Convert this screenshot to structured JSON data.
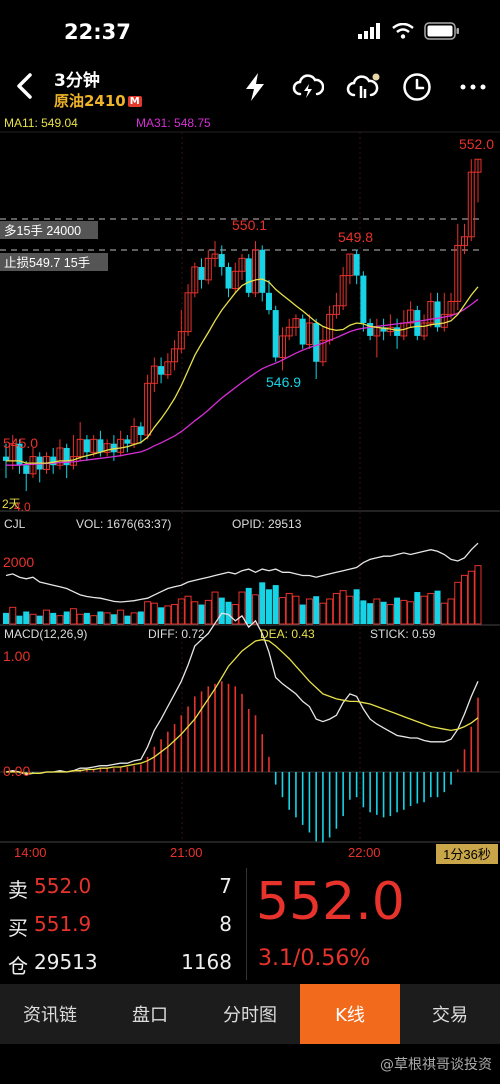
{
  "status_bar": {
    "time": "22:37"
  },
  "nav": {
    "title": "3分钟",
    "subtitle": "原油2410",
    "badge": "M",
    "icons": [
      "flash-icon",
      "cloud-sync-icon",
      "cloud-notify-icon",
      "clock-icon",
      "more-icon"
    ]
  },
  "kline": {
    "ma11_label": "MA11: 549.04",
    "ma31_label": "MA31: 548.75",
    "price_top": "552.0",
    "price_bottom": "545.0",
    "high_label_1": "550.1",
    "high_label_2": "549.8",
    "low_label": "546.9",
    "order_1": "多15手 24000",
    "order_2": "止损549.7 15手",
    "period_tag": "2天",
    "axis_partial": "4.0",
    "colors": {
      "up": "#e8322c",
      "down": "#16d3e6",
      "ma11": "#e6e04a",
      "ma31": "#d62fd6"
    }
  },
  "volume": {
    "title": "CJL",
    "vol_label": "VOL: 1676(63:37)",
    "opid_label": "OPID: 29513",
    "axis_value": "2000"
  },
  "macd": {
    "title": "MACD(12,26,9)",
    "diff_label": "DIFF: 0.72",
    "dea_label": "DEA: 0.43",
    "stick_label": "STICK: 0.59",
    "axis_top": "1.00",
    "axis_zero": "0.00"
  },
  "time_axis": {
    "t1": "14:00",
    "t2": "21:00",
    "t3": "22:00",
    "countdown": "1分36秒"
  },
  "chart_data": {
    "type": "candlestick",
    "y_range": [
      544.0,
      552.4
    ],
    "candles": [
      [
        545.1,
        545.0,
        544.6,
        545.4
      ],
      [
        545.0,
        545.4,
        544.8,
        545.6
      ],
      [
        545.4,
        544.9,
        544.7,
        545.5
      ],
      [
        544.9,
        544.7,
        544.3,
        545.0
      ],
      [
        544.7,
        545.1,
        544.6,
        545.3
      ],
      [
        545.1,
        544.8,
        544.5,
        545.2
      ],
      [
        544.8,
        545.1,
        544.7,
        545.2
      ],
      [
        545.1,
        544.9,
        544.7,
        545.3
      ],
      [
        544.9,
        545.3,
        544.8,
        545.5
      ],
      [
        545.3,
        544.9,
        544.6,
        545.4
      ],
      [
        544.9,
        545.1,
        544.8,
        545.6
      ],
      [
        545.1,
        545.5,
        545.0,
        545.9
      ],
      [
        545.5,
        545.2,
        545.0,
        545.6
      ],
      [
        545.2,
        545.5,
        545.1,
        545.6
      ],
      [
        545.5,
        545.2,
        545.1,
        545.7
      ],
      [
        545.2,
        545.4,
        545.1,
        545.5
      ],
      [
        545.4,
        545.2,
        545.0,
        545.6
      ],
      [
        545.2,
        545.5,
        545.1,
        545.7
      ],
      [
        545.5,
        545.4,
        545.2,
        545.6
      ],
      [
        545.4,
        545.8,
        545.3,
        546.0
      ],
      [
        545.8,
        545.6,
        545.4,
        545.9
      ],
      [
        545.6,
        546.8,
        545.5,
        547.0
      ],
      [
        546.8,
        547.2,
        546.6,
        547.4
      ],
      [
        547.2,
        547.0,
        546.8,
        547.4
      ],
      [
        547.0,
        547.3,
        546.9,
        547.5
      ],
      [
        547.3,
        547.6,
        547.1,
        547.8
      ],
      [
        547.6,
        548.0,
        547.5,
        548.5
      ],
      [
        548.0,
        548.9,
        547.9,
        549.1
      ],
      [
        548.9,
        549.5,
        548.8,
        549.6
      ],
      [
        549.5,
        549.2,
        549.0,
        549.7
      ],
      [
        549.2,
        549.7,
        549.1,
        549.9
      ],
      [
        549.7,
        549.8,
        549.5,
        550.1
      ],
      [
        549.8,
        549.5,
        549.3,
        550.0
      ],
      [
        549.5,
        549.0,
        548.8,
        549.6
      ],
      [
        549.0,
        549.4,
        548.9,
        549.6
      ],
      [
        549.4,
        549.7,
        549.2,
        549.8
      ],
      [
        549.7,
        548.9,
        548.8,
        549.8
      ],
      [
        548.9,
        549.9,
        548.8,
        550.1
      ],
      [
        549.9,
        548.9,
        548.7,
        550.0
      ],
      [
        548.9,
        548.5,
        548.4,
        549.2
      ],
      [
        548.5,
        547.4,
        547.3,
        548.6
      ],
      [
        547.4,
        547.9,
        547.1,
        548.1
      ],
      [
        547.9,
        548.1,
        547.8,
        548.3
      ],
      [
        548.1,
        548.3,
        547.9,
        548.4
      ],
      [
        548.3,
        547.7,
        547.6,
        548.4
      ],
      [
        547.7,
        548.2,
        547.6,
        548.4
      ],
      [
        548.2,
        547.3,
        546.9,
        548.3
      ],
      [
        547.3,
        547.8,
        547.2,
        548.1
      ],
      [
        547.8,
        548.4,
        547.7,
        548.6
      ],
      [
        548.4,
        548.6,
        548.3,
        548.9
      ],
      [
        548.6,
        549.3,
        548.5,
        549.5
      ],
      [
        549.3,
        549.8,
        549.1,
        549.8
      ],
      [
        549.8,
        549.3,
        549.1,
        549.9
      ],
      [
        549.3,
        548.2,
        548.0,
        549.4
      ],
      [
        548.2,
        547.9,
        547.8,
        548.3
      ],
      [
        547.9,
        548.1,
        547.4,
        548.3
      ],
      [
        548.1,
        548.0,
        547.8,
        548.3
      ],
      [
        548.0,
        548.1,
        547.9,
        548.4
      ],
      [
        548.1,
        547.9,
        547.6,
        548.3
      ],
      [
        547.9,
        548.2,
        547.8,
        548.5
      ],
      [
        548.2,
        548.5,
        548.1,
        548.7
      ],
      [
        548.5,
        547.9,
        547.8,
        548.6
      ],
      [
        547.9,
        548.2,
        547.8,
        548.4
      ],
      [
        548.2,
        548.7,
        548.1,
        548.9
      ],
      [
        548.7,
        548.1,
        548.0,
        548.9
      ],
      [
        548.1,
        548.4,
        548.0,
        548.9
      ],
      [
        548.4,
        548.7,
        548.3,
        548.9
      ],
      [
        548.7,
        550.0,
        548.5,
        550.5
      ],
      [
        550.0,
        550.2,
        549.8,
        550.5
      ],
      [
        550.2,
        551.7,
        550.1,
        552.0
      ],
      [
        551.7,
        552.0,
        551.0,
        552.0
      ]
    ],
    "ma11": [
      545.0,
      545.0,
      545.0,
      544.95,
      544.95,
      544.95,
      544.95,
      544.97,
      545.0,
      545.0,
      545.02,
      545.08,
      545.12,
      545.16,
      545.2,
      545.25,
      545.28,
      545.3,
      545.33,
      545.38,
      545.43,
      545.55,
      545.78,
      545.98,
      546.2,
      546.45,
      546.75,
      547.1,
      547.45,
      547.72,
      547.98,
      548.25,
      548.5,
      548.7,
      548.9,
      549.07,
      549.15,
      549.2,
      549.22,
      549.15,
      548.98,
      548.85,
      548.73,
      548.6,
      548.48,
      548.35,
      548.22,
      548.12,
      548.06,
      548.03,
      548.05,
      548.15,
      548.2,
      548.18,
      548.12,
      548.1,
      548.08,
      548.06,
      548.03,
      548.05,
      548.1,
      548.12,
      548.12,
      548.16,
      548.18,
      548.2,
      548.25,
      548.4,
      548.62,
      548.85,
      549.04
    ],
    "ma31": [
      544.9,
      544.9,
      544.9,
      544.92,
      544.92,
      544.93,
      544.94,
      544.95,
      544.96,
      544.97,
      544.98,
      545.0,
      545.02,
      545.04,
      545.06,
      545.08,
      545.1,
      545.12,
      545.15,
      545.18,
      545.21,
      545.27,
      545.35,
      545.42,
      545.5,
      545.58,
      545.68,
      545.8,
      545.93,
      546.05,
      546.18,
      546.32,
      546.46,
      546.58,
      546.7,
      546.82,
      546.93,
      547.04,
      547.14,
      547.21,
      547.27,
      547.34,
      547.42,
      547.5,
      547.57,
      547.63,
      547.68,
      547.73,
      547.8,
      547.86,
      547.93,
      548.0,
      548.05,
      548.08,
      548.1,
      548.12,
      548.14,
      548.16,
      548.18,
      548.2,
      548.22,
      548.24,
      548.26,
      548.29,
      548.31,
      548.34,
      548.37,
      548.43,
      548.52,
      548.63,
      548.75
    ],
    "volume": [
      80,
      120,
      60,
      90,
      70,
      60,
      100,
      80,
      60,
      90,
      110,
      70,
      80,
      60,
      90,
      80,
      70,
      100,
      60,
      80,
      90,
      160,
      150,
      120,
      130,
      140,
      180,
      200,
      160,
      140,
      170,
      230,
      190,
      160,
      140,
      230,
      260,
      210,
      300,
      250,
      280,
      190,
      220,
      200,
      140,
      180,
      200,
      150,
      180,
      220,
      240,
      200,
      250,
      170,
      150,
      180,
      160,
      140,
      190,
      170,
      160,
      230,
      200,
      220,
      240,
      150,
      180,
      300,
      350,
      380,
      420
    ],
    "macd_stick": [
      0.0,
      0.0,
      -0.01,
      -0.02,
      -0.01,
      0.0,
      0.0,
      0.0,
      0.01,
      0.0,
      0.01,
      0.02,
      0.02,
      0.02,
      0.03,
      0.03,
      0.03,
      0.04,
      0.04,
      0.05,
      0.06,
      0.12,
      0.2,
      0.26,
      0.32,
      0.38,
      0.45,
      0.52,
      0.6,
      0.64,
      0.68,
      0.7,
      0.72,
      0.7,
      0.68,
      0.62,
      0.5,
      0.45,
      0.3,
      0.12,
      -0.1,
      -0.2,
      -0.3,
      -0.36,
      -0.42,
      -0.48,
      -0.55,
      -0.56,
      -0.52,
      -0.45,
      -0.35,
      -0.22,
      -0.2,
      -0.28,
      -0.32,
      -0.34,
      -0.36,
      -0.35,
      -0.32,
      -0.3,
      -0.27,
      -0.25,
      -0.24,
      -0.2,
      -0.2,
      -0.16,
      -0.1,
      0.02,
      0.18,
      0.36,
      0.59
    ],
    "diff": [
      0.0,
      0.01,
      0.0,
      -0.02,
      -0.01,
      -0.01,
      0.0,
      0.0,
      0.01,
      0.0,
      0.01,
      0.03,
      0.03,
      0.04,
      0.05,
      0.05,
      0.06,
      0.07,
      0.07,
      0.09,
      0.1,
      0.2,
      0.33,
      0.42,
      0.52,
      0.62,
      0.72,
      0.85,
      1.0,
      1.05,
      1.1,
      1.18,
      1.26,
      1.25,
      1.2,
      1.24,
      1.15,
      1.2,
      1.1,
      0.95,
      0.75,
      0.7,
      0.66,
      0.62,
      0.56,
      0.52,
      0.42,
      0.4,
      0.42,
      0.45,
      0.55,
      0.62,
      0.6,
      0.5,
      0.42,
      0.38,
      0.35,
      0.32,
      0.29,
      0.28,
      0.27,
      0.27,
      0.25,
      0.24,
      0.24,
      0.24,
      0.26,
      0.34,
      0.46,
      0.6,
      0.72
    ],
    "dea": [
      0.0,
      0.0,
      0.0,
      -0.01,
      -0.01,
      -0.01,
      0.0,
      0.0,
      0.0,
      0.0,
      0.01,
      0.01,
      0.02,
      0.02,
      0.03,
      0.03,
      0.04,
      0.04,
      0.05,
      0.06,
      0.07,
      0.09,
      0.12,
      0.16,
      0.2,
      0.25,
      0.3,
      0.36,
      0.42,
      0.5,
      0.58,
      0.66,
      0.75,
      0.84,
      0.9,
      0.96,
      1.0,
      1.04,
      1.05,
      1.04,
      1.0,
      0.95,
      0.9,
      0.84,
      0.78,
      0.72,
      0.67,
      0.62,
      0.6,
      0.58,
      0.57,
      0.56,
      0.56,
      0.55,
      0.54,
      0.52,
      0.5,
      0.48,
      0.46,
      0.44,
      0.42,
      0.4,
      0.38,
      0.36,
      0.35,
      0.34,
      0.33,
      0.34,
      0.36,
      0.39,
      0.43
    ],
    "vol_line": [
      1500,
      1550,
      1450,
      1400,
      1450,
      1300,
      1250,
      1200,
      1150,
      1100,
      1000,
      900,
      850,
      820,
      800,
      750,
      700,
      680,
      700,
      720,
      760,
      800,
      900,
      1000,
      1100,
      1150,
      1200,
      1300,
      1350,
      1400,
      1450,
      1500,
      1550,
      1600,
      1550,
      1650,
      1700,
      1600,
      1700,
      1650,
      1700,
      1600,
      1600,
      1550,
      1500,
      1500,
      1450,
      1500,
      1550,
      1600,
      1650,
      1700,
      1750,
      1900,
      2000,
      2050,
      2100,
      2100,
      2150,
      2200,
      2150,
      2200,
      2250,
      2300,
      2250,
      2150,
      2000,
      1950,
      2050,
      2300,
      2500
    ]
  },
  "quote": {
    "sell_label": "卖",
    "sell_price": "552.0",
    "sell_qty": "7",
    "buy_label": "买",
    "buy_price": "551.9",
    "buy_qty": "8",
    "oi_label": "仓",
    "oi_value": "29513",
    "oi_change": "1168",
    "last_price": "552.0",
    "change": "3.1/0.56%"
  },
  "tabs": [
    "资讯链",
    "盘口",
    "分时图",
    "K线",
    "交易"
  ],
  "active_tab": "K线",
  "watermark": "@草根祺哥谈投资"
}
